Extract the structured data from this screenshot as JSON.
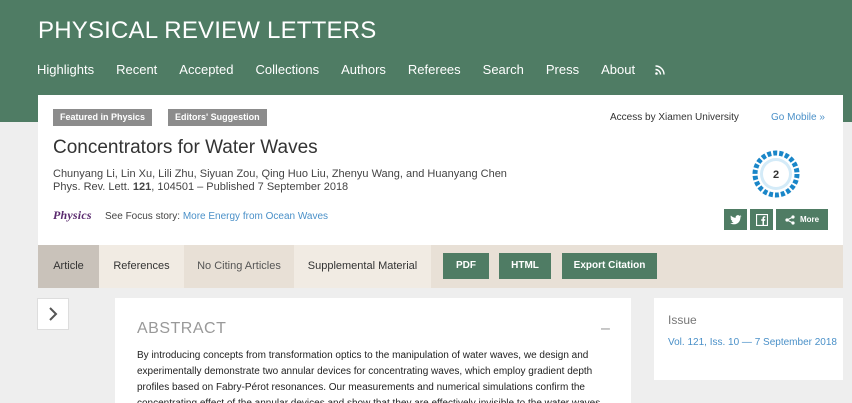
{
  "header": {
    "site_title": "PHYSICAL REVIEW LETTERS",
    "nav": [
      "Highlights",
      "Recent",
      "Accepted",
      "Collections",
      "Authors",
      "Referees",
      "Search",
      "Press",
      "About"
    ],
    "rss_icon": "rss-icon"
  },
  "article": {
    "badges": [
      "Featured in Physics",
      "Editors' Suggestion"
    ],
    "access": "Access by Xiamen University",
    "go_mobile": "Go Mobile »",
    "title": "Concentrators for Water Waves",
    "authors": "Chunyang Li, Lin Xu, Lili Zhu, Siyuan Zou, Qing Huo Liu, Zhenyu Wang, and Huanyang Chen",
    "citation_prefix": "Phys. Rev. Lett. ",
    "volume": "121",
    "citation_suffix": ", 104501 – Published 7 September 2018",
    "physics_logo": "Physics",
    "focus_prefix": "See Focus story: ",
    "focus_link": "More Energy from Ocean Waves",
    "altmetric_score": "2",
    "share": {
      "twitter_icon": "twitter-icon",
      "facebook_icon": "facebook-icon",
      "more_label": "More"
    }
  },
  "tabs": {
    "article": "Article",
    "references": "References",
    "no_citing": "No Citing Articles",
    "supplemental": "Supplemental Material",
    "pdf": "PDF",
    "html": "HTML",
    "export": "Export Citation"
  },
  "abstract": {
    "heading": "ABSTRACT",
    "collapse": "–",
    "text": "By introducing concepts from transformation optics to the manipulation of water waves, we design and experimentally demonstrate two annular devices for concentrating waves, which employ gradient depth profiles based on Fabry-Pérot resonances. Our measurements and numerical simulations confirm the concentrating effect of the annular devices and show that they are effectively invisible to the water waves."
  },
  "issue": {
    "heading": "Issue",
    "link": "Vol. 121, Iss. 10 — 7 September 2018"
  },
  "colors": {
    "brand_green": "#4f7c64",
    "link_blue": "#4a90c8",
    "badge_gray": "#8c8c8c",
    "tab_bg": "#e8e0d6",
    "altmetric_blue": "#1a86c8"
  }
}
